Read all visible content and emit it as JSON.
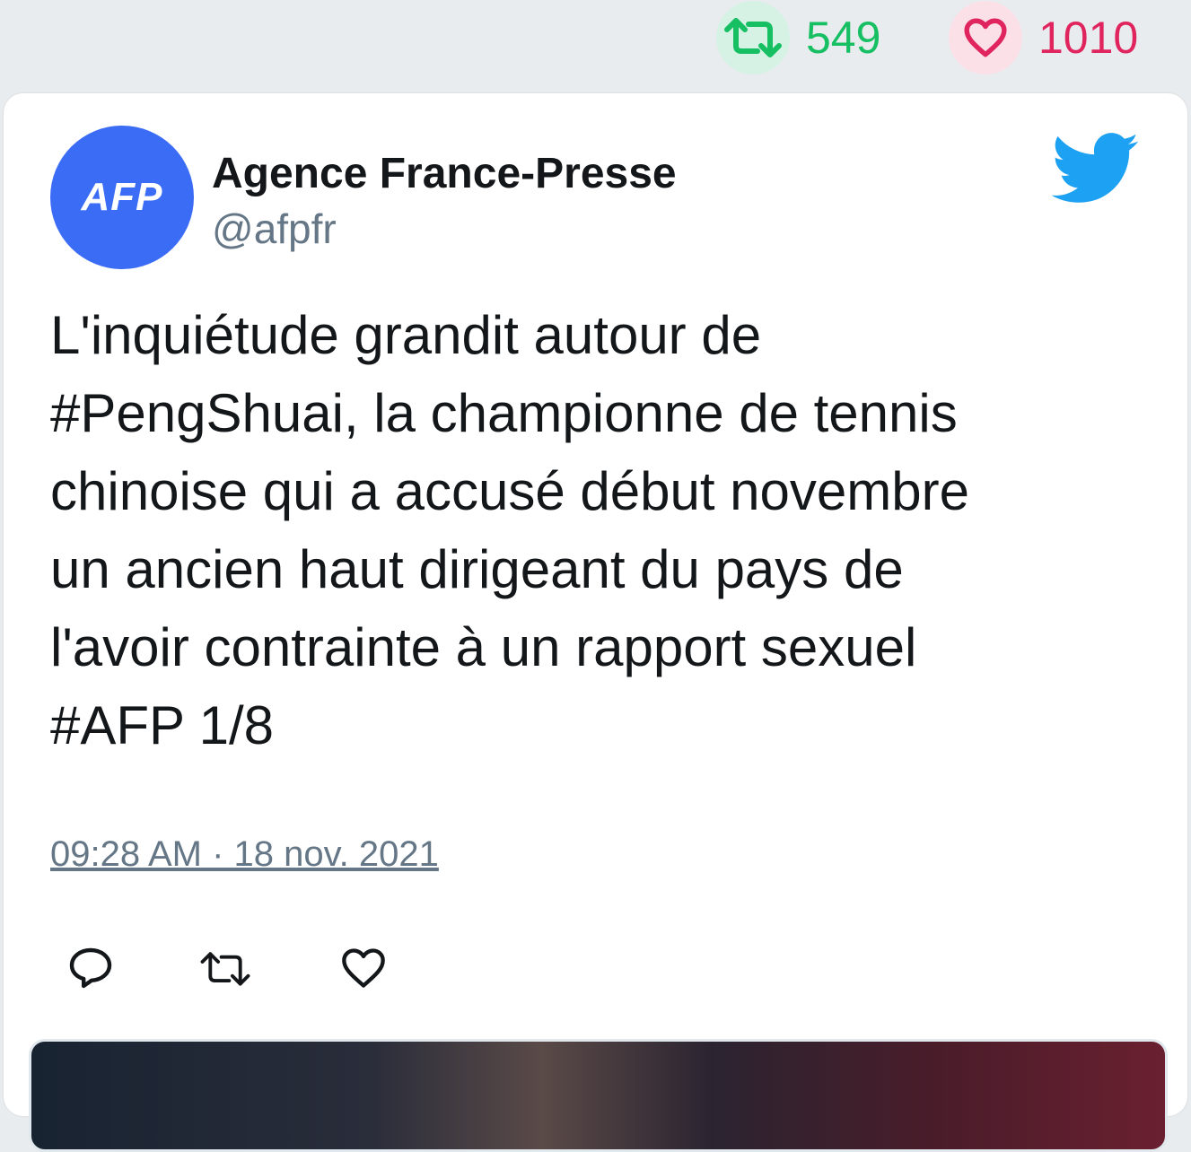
{
  "stats": {
    "retweets": "549",
    "likes": "1010"
  },
  "author": {
    "avatar_text": "AFP",
    "name": "Agence France-Presse",
    "handle": "@afpfr"
  },
  "tweet": {
    "lines": [
      "L'inquiétude grandit autour de",
      "#PengShuai, la championne de tennis",
      "chinoise qui a accusé début novembre",
      "un ancien haut dirigeant du pays de",
      "l'avoir contrainte à un rapport sexuel",
      "#AFP 1/8"
    ],
    "timestamp": "09:28 AM · 18 nov. 2021"
  },
  "icons": {
    "retweet": "retweet-icon",
    "like": "heart-icon",
    "reply": "reply-icon",
    "brand": "twitter-bird-icon"
  },
  "colors": {
    "retweet": "#17bf63",
    "like": "#e0245e",
    "twitter_blue": "#1da1f2",
    "avatar_bg": "#3b6cf6"
  }
}
